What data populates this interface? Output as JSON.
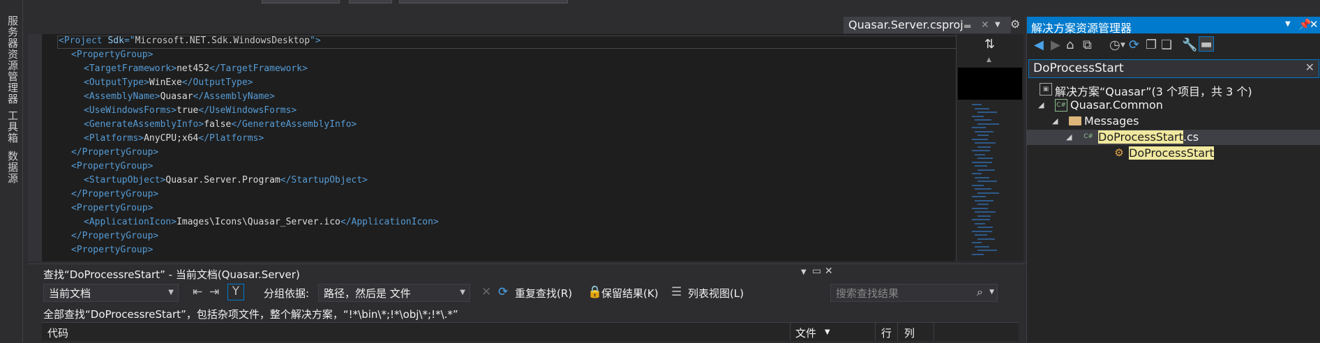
{
  "left_strip": {
    "tabs": [
      "服务器资源管理器",
      "工具箱",
      "数据源"
    ]
  },
  "document_tab": {
    "title": "Quasar.Server.csproj"
  },
  "editor": {
    "lines": [
      {
        "indent": 0,
        "parts": [
          [
            "tag",
            "<Project "
          ],
          [
            "attr",
            "Sdk"
          ],
          [
            "tag",
            "=\""
          ],
          [
            "val",
            "Microsoft.NET.Sdk.WindowsDesktop"
          ],
          [
            "tag",
            "\">"
          ]
        ]
      },
      {
        "indent": 1,
        "parts": [
          [
            "tag",
            "<PropertyGroup>"
          ]
        ]
      },
      {
        "indent": 2,
        "parts": [
          [
            "tag",
            "<TargetFramework>"
          ],
          [
            "txt",
            "net452"
          ],
          [
            "tag",
            "</TargetFramework>"
          ]
        ]
      },
      {
        "indent": 2,
        "parts": [
          [
            "tag",
            "<OutputType>"
          ],
          [
            "txt",
            "WinExe"
          ],
          [
            "tag",
            "</OutputType>"
          ]
        ]
      },
      {
        "indent": 2,
        "parts": [
          [
            "tag",
            "<AssemblyName>"
          ],
          [
            "txt",
            "Quasar"
          ],
          [
            "tag",
            "</AssemblyName>"
          ]
        ]
      },
      {
        "indent": 2,
        "parts": [
          [
            "tag",
            "<UseWindowsForms>"
          ],
          [
            "txt",
            "true"
          ],
          [
            "tag",
            "</UseWindowsForms>"
          ]
        ]
      },
      {
        "indent": 2,
        "parts": [
          [
            "tag",
            "<GenerateAssemblyInfo>"
          ],
          [
            "txt",
            "false"
          ],
          [
            "tag",
            "</GenerateAssemblyInfo>"
          ]
        ]
      },
      {
        "indent": 2,
        "parts": [
          [
            "tag",
            "<Platforms>"
          ],
          [
            "txt",
            "AnyCPU;x64"
          ],
          [
            "tag",
            "</Platforms>"
          ]
        ]
      },
      {
        "indent": 1,
        "parts": [
          [
            "tag",
            "</PropertyGroup>"
          ]
        ]
      },
      {
        "indent": 1,
        "parts": [
          [
            "tag",
            "<PropertyGroup>"
          ]
        ]
      },
      {
        "indent": 2,
        "parts": [
          [
            "tag",
            "<StartupObject>"
          ],
          [
            "txt",
            "Quasar.Server.Program"
          ],
          [
            "tag",
            "</StartupObject>"
          ]
        ]
      },
      {
        "indent": 1,
        "parts": [
          [
            "tag",
            "</PropertyGroup>"
          ]
        ]
      },
      {
        "indent": 1,
        "parts": [
          [
            "tag",
            "<PropertyGroup>"
          ]
        ]
      },
      {
        "indent": 2,
        "parts": [
          [
            "tag",
            "<ApplicationIcon>"
          ],
          [
            "txt",
            "Images\\Icons\\Quasar_Server.ico"
          ],
          [
            "tag",
            "</ApplicationIcon>"
          ]
        ]
      },
      {
        "indent": 1,
        "parts": [
          [
            "tag",
            "</PropertyGroup>"
          ]
        ]
      },
      {
        "indent": 1,
        "parts": [
          [
            "tag",
            "<PropertyGroup>"
          ]
        ]
      }
    ]
  },
  "solution_explorer": {
    "title": "解决方案资源管理器",
    "search_value": "DoProcessStart",
    "tree": [
      {
        "label": "解决方案“Quasar”(3 个项目，共 3 个)",
        "level": 0,
        "icon": "solution-icon"
      },
      {
        "label": "Quasar.Common",
        "level": 1,
        "icon": "csharp-project-icon",
        "expanded": true
      },
      {
        "label": "Messages",
        "level": 2,
        "icon": "folder-open-icon",
        "expanded": true
      },
      {
        "label_highlight": "DoProcessStart",
        "label_rest": ".cs",
        "level": 3,
        "icon": "csharp-file-icon",
        "expanded": true,
        "selected": true
      },
      {
        "label_highlight": "DoProcessStart",
        "label_rest": "",
        "level": 4,
        "icon": "class-icon"
      }
    ]
  },
  "find_results": {
    "title": "查找“DoProcessreStart” - 当前文档(Quasar.Server)",
    "scope": "当前文档",
    "group_by_label": "分组依据:",
    "group_by_value": "路径，然后是 文件",
    "refind_label": "重复查找(R)",
    "keep_results_label": "保留结果(K)",
    "list_view_label": "列表视图(L)",
    "search_placeholder": "搜索查找结果",
    "summary": "全部查找“DoProcessreStart”，包括杂项文件，整个解决方案，“!*\\bin\\*;!*\\obj\\*;!*\\.*”",
    "columns": {
      "code": "代码",
      "file": "文件",
      "line": "行",
      "col": "列"
    }
  }
}
